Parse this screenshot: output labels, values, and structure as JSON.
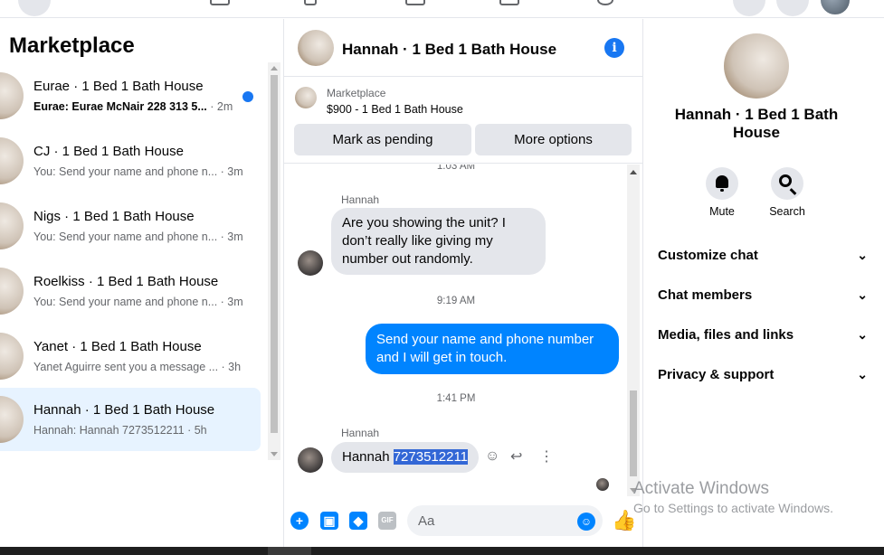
{
  "left": {
    "heading": "Marketplace",
    "conversations": [
      {
        "title": "Eurae · 1 Bed 1 Bath House",
        "snippet": "Eurae: Eurae McNair 228 313 5...",
        "time": " · 2m",
        "unread": true
      },
      {
        "title": "CJ · 1 Bed 1 Bath House",
        "snippet": "You: Send your name and phone n...",
        "time": " · 3m",
        "unread": false
      },
      {
        "title": "Nigs · 1 Bed 1 Bath House",
        "snippet": "You: Send your name and phone n...",
        "time": " · 3m",
        "unread": false
      },
      {
        "title": "Roelkiss · 1 Bed 1 Bath House",
        "snippet": "You: Send your name and phone n...",
        "time": " · 3m",
        "unread": false
      },
      {
        "title": "Yanet · 1 Bed 1 Bath House",
        "snippet": "Yanet Aguirre sent you a message ...",
        "time": " · 3h",
        "unread": false
      },
      {
        "title": "Hannah · 1 Bed 1 Bath House",
        "snippet": "Hannah: Hannah 7273512211",
        "time": " · 5h",
        "unread": false,
        "active": true
      }
    ]
  },
  "chat": {
    "title": "Hannah · 1 Bed 1 Bath House",
    "info_icon": "i",
    "listing": {
      "source": "Marketplace",
      "price_title": "$900 - 1 Bed 1 Bath House",
      "mark_pending": "Mark as pending",
      "more_options": "More options"
    },
    "partial_time": "1:03 AM",
    "messages": {
      "m1_sender": "Hannah",
      "m1_text": "Are you showing the unit? I don’t really like giving my number out randomly.",
      "t2": "9:19 AM",
      "m2_text": "Send your name and phone number and I will get in touch.",
      "t3": "1:41 PM",
      "m3_sender": "Hannah",
      "m3_name": "Hannah ",
      "m3_number": "7273512211"
    },
    "composer": {
      "placeholder": "Aa",
      "plus": "+",
      "gif": "GIF"
    }
  },
  "info": {
    "name": "Hannah · 1 Bed 1 Bath House",
    "mute": "Mute",
    "search": "Search",
    "sections": [
      "Customize chat",
      "Chat members",
      "Media, files and links",
      "Privacy & support"
    ]
  },
  "watermark": {
    "line1": "Activate Windows",
    "line2": "Go to Settings to activate Windows."
  },
  "colors": {
    "accent": "#1877f2",
    "bubble_out": "#0084ff",
    "active_row": "#e7f3ff"
  }
}
